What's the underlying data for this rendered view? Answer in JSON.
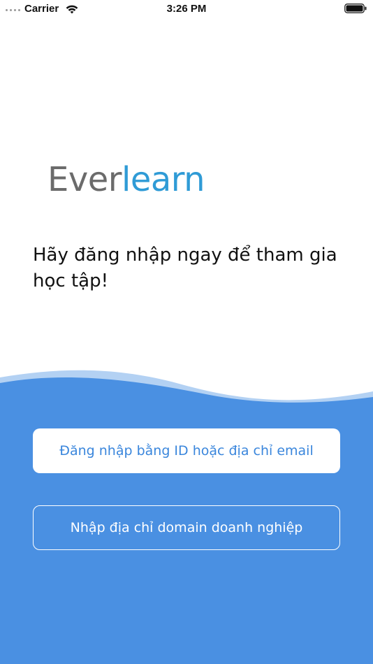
{
  "status_bar": {
    "carrier": "Carrier",
    "time": "3:26 PM",
    "signal_icon": "signal-dots-icon",
    "wifi_icon": "wifi-icon",
    "battery_icon": "battery-icon"
  },
  "logo": {
    "part1": "Ever",
    "part2": "learn"
  },
  "headline": "Hãy đăng nhập ngay để tham gia học tập!",
  "buttons": {
    "login_id_email": "Đăng nhập bằng ID hoặc địa chỉ email",
    "enter_domain": "Nhập địa chỉ domain doanh nghiệp"
  },
  "colors": {
    "brand_blue": "#4a90e2",
    "logo_gray": "#6b6b6b",
    "logo_blue": "#2f9bd6",
    "wave_light": "#b3d1f3",
    "primary_button_text": "#3a86dc"
  }
}
